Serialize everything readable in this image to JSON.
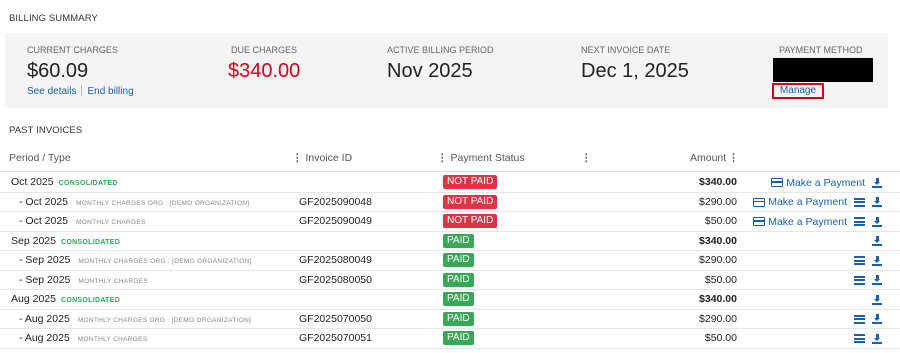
{
  "billing_summary": {
    "title": "BILLING SUMMARY",
    "current_charges": {
      "label": "CURRENT CHARGES",
      "value": "$60.09",
      "see_details": "See details",
      "end_billing": "End billing"
    },
    "due_charges": {
      "label": "DUE CHARGES",
      "value": "$340.00",
      "color": "#d0021b"
    },
    "active_billing_period": {
      "label": "ACTIVE BILLING PERIOD",
      "value": "Nov 2025"
    },
    "next_invoice_date": {
      "label": "NEXT INVOICE DATE",
      "value": "Dec 1, 2025"
    },
    "payment_method": {
      "label": "PAYMENT METHOD",
      "manage": "Manage"
    }
  },
  "past_invoices": {
    "title": "PAST INVOICES",
    "columns": {
      "period": "Period / Type",
      "invoice_id": "Invoice ID",
      "payment_status": "Payment Status",
      "amount": "Amount"
    },
    "make_payment_label": "Make a Payment",
    "rows": [
      {
        "period": "Oct 2025",
        "type": "CONSOLIDATED",
        "invoice_id": "",
        "status": "NOT PAID",
        "amount": "$340.00",
        "parent": true,
        "make_payment": true,
        "list": false
      },
      {
        "period": "- Oct 2025",
        "type": "MONTHLY CHARGES ORG : [DEMO ORGANIZATION]",
        "invoice_id": "GF2025090048",
        "status": "NOT PAID",
        "amount": "$290.00",
        "parent": false,
        "make_payment": true,
        "list": true
      },
      {
        "period": "- Oct 2025",
        "type": "MONTHLY CHARGES",
        "invoice_id": "GF2025090049",
        "status": "NOT PAID",
        "amount": "$50.00",
        "parent": false,
        "make_payment": true,
        "list": true
      },
      {
        "period": "Sep 2025",
        "type": "CONSOLIDATED",
        "invoice_id": "",
        "status": "PAID",
        "amount": "$340.00",
        "parent": true,
        "make_payment": false,
        "list": false
      },
      {
        "period": "- Sep 2025",
        "type": "MONTHLY CHARGES ORG : [DEMO ORGANIZATION]",
        "invoice_id": "GF2025080049",
        "status": "PAID",
        "amount": "$290.00",
        "parent": false,
        "make_payment": false,
        "list": true
      },
      {
        "period": "- Sep 2025",
        "type": "MONTHLY CHARGES",
        "invoice_id": "GF2025080050",
        "status": "PAID",
        "amount": "$50.00",
        "parent": false,
        "make_payment": false,
        "list": true
      },
      {
        "period": "Aug 2025",
        "type": "CONSOLIDATED",
        "invoice_id": "",
        "status": "PAID",
        "amount": "$340.00",
        "parent": true,
        "make_payment": false,
        "list": false
      },
      {
        "period": "- Aug 2025",
        "type": "MONTHLY CHARGES ORG : [DEMO ORGANIZATION]",
        "invoice_id": "GF2025070050",
        "status": "PAID",
        "amount": "$290.00",
        "parent": false,
        "make_payment": false,
        "list": true
      },
      {
        "period": "- Aug 2025",
        "type": "MONTHLY CHARGES",
        "invoice_id": "GF2025070051",
        "status": "PAID",
        "amount": "$50.00",
        "parent": false,
        "make_payment": false,
        "list": true
      }
    ]
  }
}
